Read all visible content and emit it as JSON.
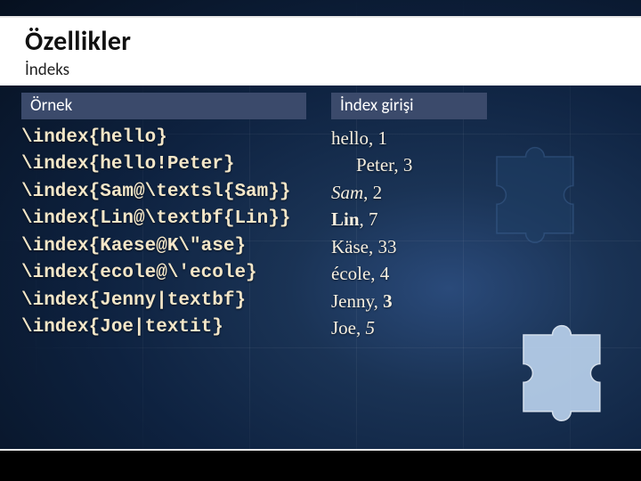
{
  "header": {
    "title": "Özellikler",
    "subtitle": "İndeks"
  },
  "columns": {
    "left": {
      "heading": "Örnek",
      "lines": [
        "\\index{hello}",
        "\\index{hello!Peter}",
        "\\index{Sam@\\textsl{Sam}}",
        "\\index{Lin@\\textbf{Lin}}",
        "\\index{Kaese@K\\\"ase}",
        "\\index{ecole@\\'ecole}",
        "\\index{Jenny|textbf}",
        "\\index{Joe|textit}"
      ]
    },
    "right": {
      "heading": "İndex girişi",
      "entries": [
        {
          "word": "hello",
          "page": "1",
          "style": "",
          "page_style": "",
          "indent": false
        },
        {
          "word": "Peter",
          "page": "3",
          "style": "",
          "page_style": "",
          "indent": true
        },
        {
          "word": "Sam",
          "page": "2",
          "style": "sl",
          "page_style": "",
          "indent": false
        },
        {
          "word": "Lin",
          "page": "7",
          "style": "bf",
          "page_style": "",
          "indent": false
        },
        {
          "word": "Käse",
          "page": "33",
          "style": "",
          "page_style": "",
          "indent": false
        },
        {
          "word": "école",
          "page": "4",
          "style": "",
          "page_style": "",
          "indent": false
        },
        {
          "word": "Jenny",
          "page": "3",
          "style": "",
          "page_style": "bf",
          "indent": false
        },
        {
          "word": "Joe",
          "page": "5",
          "style": "",
          "page_style": "it",
          "indent": false
        }
      ]
    }
  }
}
